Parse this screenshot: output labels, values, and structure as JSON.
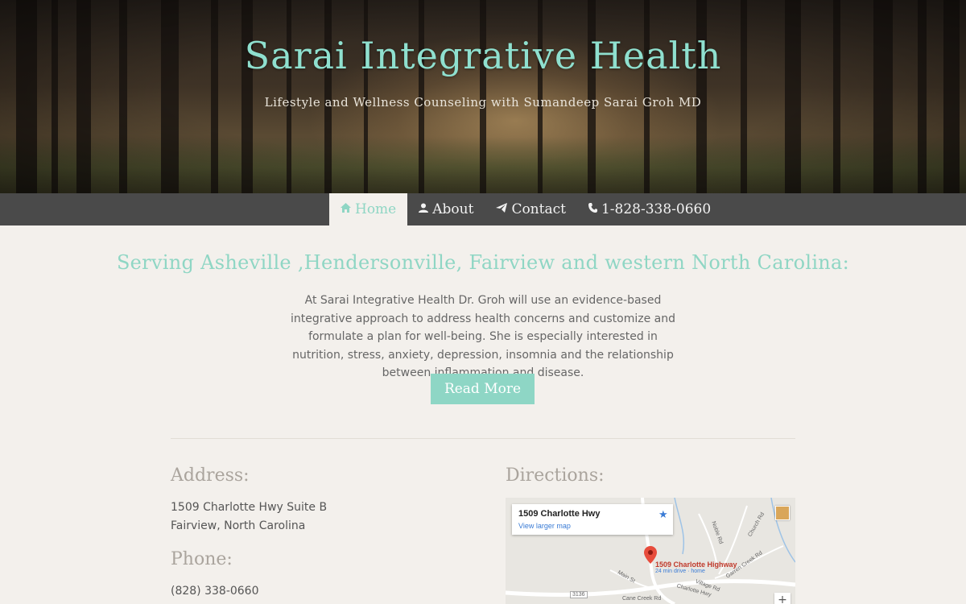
{
  "header": {
    "title": "Sarai Integrative Health",
    "subtitle": "Lifestyle and Wellness Counseling with Sumandeep Sarai Groh MD"
  },
  "nav": {
    "items": [
      {
        "label": "Home",
        "icon": "home-icon",
        "active": true
      },
      {
        "label": "About",
        "icon": "user-md-icon",
        "active": false
      },
      {
        "label": "Contact",
        "icon": "paper-plane-icon",
        "active": false
      },
      {
        "label": "1-828-338-0660",
        "icon": "phone-icon",
        "active": false
      }
    ]
  },
  "main": {
    "heading": "Serving Asheville ,Hendersonville, Fairview and western North Carolina:",
    "intro": "At Sarai Integrative Health Dr. Groh will use an evidence-based integrative approach to address health concerns and customize and formulate a plan for well-being. She is especially interested in nutrition, stress, anxiety, depression, insomnia and the relationship between inflammation and disease.",
    "read_more": "Read More"
  },
  "contact": {
    "address_label": "Address:",
    "address_line1": "1509 Charlotte Hwy Suite B",
    "address_line2": "Fairview, North Carolina",
    "phone_label": "Phone:",
    "phone": "(828) 338-0660",
    "directions_label": "Directions:"
  },
  "map": {
    "place_name": "1509 Charlotte Hwy",
    "larger_map": "View larger map",
    "marker_label": "1509 Charlotte Highway",
    "marker_sub": "24 min drive · home",
    "zoom_in": "+",
    "roads": [
      "Noble Rd",
      "Church Rd",
      "Garren Creek Rd",
      "Village Rd",
      "Main St",
      "Charlotte Hwy",
      "Cane Creek Rd",
      "3136"
    ]
  },
  "colors": {
    "accent": "#8fd6c4",
    "nav_bg": "#4a4a4a",
    "page_bg": "#f3f0ec"
  }
}
